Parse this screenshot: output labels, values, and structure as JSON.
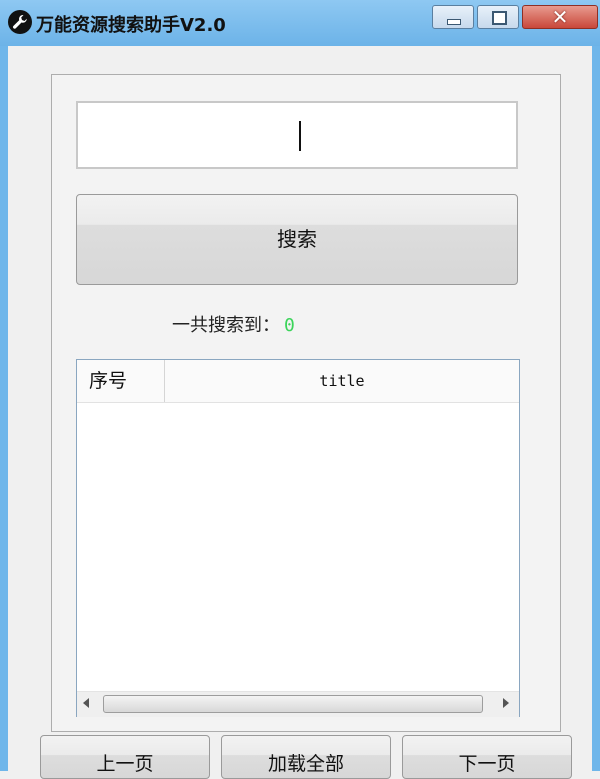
{
  "window": {
    "title": "万能资源搜索助手V2.0",
    "close_glyph": "✕"
  },
  "search": {
    "input_value": "",
    "button_label": "搜索"
  },
  "result": {
    "count_label": "一共搜索到：",
    "count_value": "0"
  },
  "table": {
    "columns": [
      "序号",
      "title"
    ],
    "rows": []
  },
  "nav": {
    "prev_label": "上一页",
    "load_all_label": "加载全部",
    "next_label": "下一页"
  },
  "colors": {
    "titlebar": "#6cb3e8",
    "count_value": "#3bd45a",
    "close_button": "#c9473a"
  },
  "icons": {
    "app": "wrench-icon",
    "minimize": "minimize-icon",
    "maximize": "maximize-icon",
    "close": "close-icon",
    "scroll_left": "arrow-left-icon",
    "scroll_right": "arrow-right-icon"
  }
}
